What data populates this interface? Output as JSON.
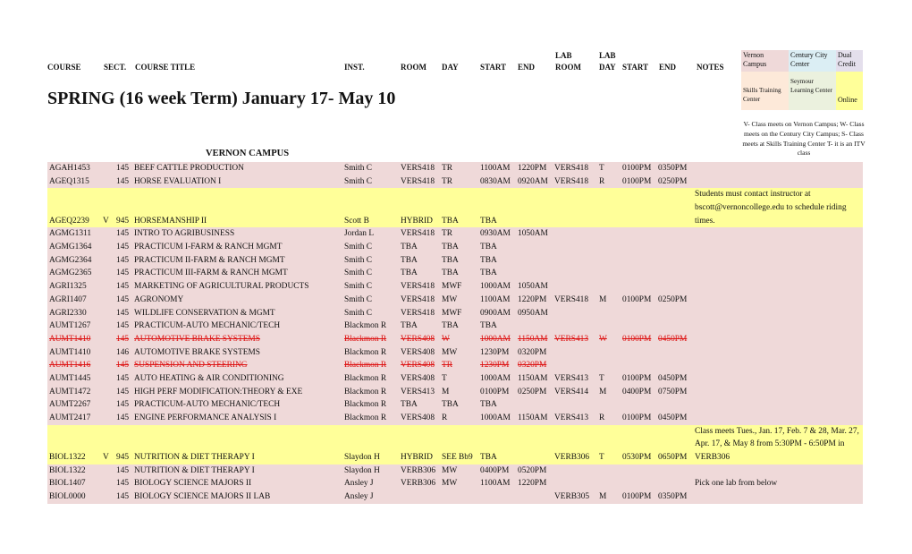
{
  "headers": {
    "course": "COURSE",
    "sect": "SECT.",
    "course_title": "COURSE TITLE",
    "inst": "INST.",
    "room": "ROOM",
    "day": "DAY",
    "start": "START",
    "end": "END",
    "lab_room_1": "LAB",
    "lab_room_2": "ROOM",
    "lab_day_1": "LAB",
    "lab_day_2": "DAY",
    "lab_start": "START",
    "lab_end": "END",
    "notes": "NOTES"
  },
  "term_title": "SPRING (16 week Term) January 17- May 10",
  "section_title": "VERNON CAMPUS",
  "legend": {
    "items": [
      {
        "label": "Vernon Campus",
        "color": "#efd9d9"
      },
      {
        "label": "Century City Center",
        "color": "#dbeef4"
      },
      {
        "label": "Dual Credit",
        "color": "#e4dfec"
      },
      {
        "label": "Skills Training Center",
        "color": "#fde9d9"
      },
      {
        "label": "Seymour Learning Center",
        "color": "#ebf1de"
      },
      {
        "label": "Online",
        "color": "#ffff99"
      }
    ],
    "note": "V- Class meets on Vernon Campus; W- Class meets on the Century City Campus; S- Class meets at Skills Training Center T- it is an ITV class"
  },
  "rows": [
    {
      "course": "AGAH1453",
      "flag": "",
      "sect": "145",
      "title": "BEEF CATTLE PRODUCTION",
      "inst": "Smith C",
      "room": "VERS418",
      "day": "TR",
      "start": "1100AM",
      "end": "1220PM",
      "lab_room": "VERS418",
      "lab_day": "T",
      "lab_start": "0100PM",
      "lab_end": "0350PM",
      "notes": "",
      "style": "pink"
    },
    {
      "course": "AGEQ1315",
      "flag": "",
      "sect": "145",
      "title": "HORSE EVALUATION I",
      "inst": "Smith C",
      "room": "VERS418",
      "day": "TR",
      "start": "0830AM",
      "end": "0920AM",
      "lab_room": "VERS418",
      "lab_day": "R",
      "lab_start": "0100PM",
      "lab_end": "0250PM",
      "notes": "",
      "style": "pink"
    },
    {
      "course": "AGEQ2239",
      "flag": "V",
      "sect": "945",
      "title": "HORSEMANSHIP II",
      "inst": "Scott B",
      "room": "HYBRID",
      "day": "TBA",
      "start": "TBA",
      "end": "",
      "lab_room": "",
      "lab_day": "",
      "lab_start": "",
      "lab_end": "",
      "notes": "Students must contact instructor at bscott@vernoncollege.edu to schedule riding times.",
      "style": "yellow"
    },
    {
      "course": "AGMG1311",
      "flag": "",
      "sect": "145",
      "title": "INTRO TO AGRIBUSINESS",
      "inst": "Jordan L",
      "room": "VERS418",
      "day": "TR",
      "start": "0930AM",
      "end": "1050AM",
      "lab_room": "",
      "lab_day": "",
      "lab_start": "",
      "lab_end": "",
      "notes": "",
      "style": "pink"
    },
    {
      "course": "AGMG1364",
      "flag": "",
      "sect": "145",
      "title": "PRACTICUM I-FARM & RANCH MGMT",
      "inst": "Smith C",
      "room": "TBA",
      "day": "TBA",
      "start": "TBA",
      "end": "",
      "lab_room": "",
      "lab_day": "",
      "lab_start": "",
      "lab_end": "",
      "notes": "",
      "style": "pink"
    },
    {
      "course": "AGMG2364",
      "flag": "",
      "sect": "145",
      "title": "PRACTICUM II-FARM & RANCH MGMT",
      "inst": "Smith C",
      "room": "TBA",
      "day": "TBA",
      "start": "TBA",
      "end": "",
      "lab_room": "",
      "lab_day": "",
      "lab_start": "",
      "lab_end": "",
      "notes": "",
      "style": "pink"
    },
    {
      "course": "AGMG2365",
      "flag": "",
      "sect": "145",
      "title": "PRACTICUM III-FARM & RANCH MGMT",
      "inst": "Smith C",
      "room": "TBA",
      "day": "TBA",
      "start": "TBA",
      "end": "",
      "lab_room": "",
      "lab_day": "",
      "lab_start": "",
      "lab_end": "",
      "notes": "",
      "style": "pink"
    },
    {
      "course": "AGRI1325",
      "flag": "",
      "sect": "145",
      "title": "MARKETING OF AGRICULTURAL PRODUCTS",
      "inst": "Smith C",
      "room": "VERS418",
      "day": "MWF",
      "start": "1000AM",
      "end": "1050AM",
      "lab_room": "",
      "lab_day": "",
      "lab_start": "",
      "lab_end": "",
      "notes": "",
      "style": "pink"
    },
    {
      "course": "AGRI1407",
      "flag": "",
      "sect": "145",
      "title": "AGRONOMY",
      "inst": "Smith C",
      "room": "VERS418",
      "day": "MW",
      "start": "1100AM",
      "end": "1220PM",
      "lab_room": "VERS418",
      "lab_day": "M",
      "lab_start": "0100PM",
      "lab_end": "0250PM",
      "notes": "",
      "style": "pink"
    },
    {
      "course": "AGRI2330",
      "flag": "",
      "sect": "145",
      "title": "WILDLIFE CONSERVATION & MGMT",
      "inst": "Smith C",
      "room": "VERS418",
      "day": "MWF",
      "start": "0900AM",
      "end": "0950AM",
      "lab_room": "",
      "lab_day": "",
      "lab_start": "",
      "lab_end": "",
      "notes": "",
      "style": "pink"
    },
    {
      "course": "AUMT1267",
      "flag": "",
      "sect": "145",
      "title": "PRACTICUM-AUTO MECHANIC/TECH",
      "inst": "Blackmon R",
      "room": "TBA",
      "day": "TBA",
      "start": "TBA",
      "end": "",
      "lab_room": "",
      "lab_day": "",
      "lab_start": "",
      "lab_end": "",
      "notes": "",
      "style": "pink"
    },
    {
      "course": "AUMT1410",
      "flag": "",
      "sect": "145",
      "title": "AUTOMOTIVE BRAKE SYSTEMS",
      "inst": "Blackmon R",
      "room": "VERS408",
      "day": "W",
      "start": "1000AM",
      "end": "1150AM",
      "lab_room": "VERS413",
      "lab_day": "W",
      "lab_start": "0100PM",
      "lab_end": "0450PM",
      "notes": "",
      "style": "pink cancel"
    },
    {
      "course": "AUMT1410",
      "flag": "",
      "sect": "146",
      "title": "AUTOMOTIVE BRAKE SYSTEMS",
      "inst": "Blackmon R",
      "room": "VERS408",
      "day": "MW",
      "start": "1230PM",
      "end": "0320PM",
      "lab_room": "",
      "lab_day": "",
      "lab_start": "",
      "lab_end": "",
      "notes": "",
      "style": "pink"
    },
    {
      "course": "AUMT1416",
      "flag": "",
      "sect": "145",
      "title": "SUSPENSION AND STEERING",
      "inst": "Blackmon R",
      "room": "VERS408",
      "day": "TR",
      "start": "1230PM",
      "end": "0320PM",
      "lab_room": "",
      "lab_day": "",
      "lab_start": "",
      "lab_end": "",
      "notes": "",
      "style": "pink cancel"
    },
    {
      "course": "AUMT1445",
      "flag": "",
      "sect": "145",
      "title": "AUTO HEATING & AIR CONDITIONING",
      "inst": "Blackmon R",
      "room": "VERS408",
      "day": "T",
      "start": "1000AM",
      "end": "1150AM",
      "lab_room": "VERS413",
      "lab_day": "T",
      "lab_start": "0100PM",
      "lab_end": "0450PM",
      "notes": "",
      "style": "pink"
    },
    {
      "course": "AUMT1472",
      "flag": "",
      "sect": "145",
      "title": "HIGH PERF MODIFICATION:THEORY & EXE",
      "inst": "Blackmon R",
      "room": "VERS413",
      "day": "M",
      "start": "0100PM",
      "end": "0250PM",
      "lab_room": "VERS414",
      "lab_day": "M",
      "lab_start": "0400PM",
      "lab_end": "0750PM",
      "notes": "",
      "style": "pink"
    },
    {
      "course": "AUMT2267",
      "flag": "",
      "sect": "145",
      "title": "PRACTICUM-AUTO MECHANIC/TECH",
      "inst": "Blackmon R",
      "room": "TBA",
      "day": "TBA",
      "start": "TBA",
      "end": "",
      "lab_room": "",
      "lab_day": "",
      "lab_start": "",
      "lab_end": "",
      "notes": "",
      "style": "pink"
    },
    {
      "course": "AUMT2417",
      "flag": "",
      "sect": "145",
      "title": "ENGINE PERFORMANCE ANALYSIS I",
      "inst": "Blackmon R",
      "room": "VERS408",
      "day": "R",
      "start": "1000AM",
      "end": "1150AM",
      "lab_room": "VERS413",
      "lab_day": "R",
      "lab_start": "0100PM",
      "lab_end": "0450PM",
      "notes": "",
      "style": "pink"
    },
    {
      "course": "BIOL1322",
      "flag": "V",
      "sect": "945",
      "title": "NUTRITION & DIET THERAPY I",
      "inst": "Slaydon H",
      "room": "HYBRID",
      "day": "SEE Bb9",
      "start": "TBA",
      "end": "",
      "lab_room": "VERB306",
      "lab_day": "T",
      "lab_start": "0530PM",
      "lab_end": "0650PM",
      "notes": "Class meets Tues., Jan. 17, Feb. 7 & 28, Mar. 27, Apr. 17, & May 8 from 5:30PM - 6:50PM in VERB306",
      "style": "yellow"
    },
    {
      "course": "BIOL1322",
      "flag": "",
      "sect": "145",
      "title": "NUTRITION & DIET THERAPY I",
      "inst": "Slaydon H",
      "room": "VERB306",
      "day": "MW",
      "start": "0400PM",
      "end": "0520PM",
      "lab_room": "",
      "lab_day": "",
      "lab_start": "",
      "lab_end": "",
      "notes": "",
      "style": "pink"
    },
    {
      "course": "BIOL1407",
      "flag": "",
      "sect": "145",
      "title": "BIOLOGY SCIENCE MAJORS II",
      "inst": "Ansley J",
      "room": "VERB306",
      "day": "MW",
      "start": "1100AM",
      "end": "1220PM",
      "lab_room": "",
      "lab_day": "",
      "lab_start": "",
      "lab_end": "",
      "notes": "Pick one lab from below",
      "style": "pink"
    },
    {
      "course": "BIOL0000",
      "flag": "",
      "sect": "145",
      "title": "BIOLOGY SCIENCE MAJORS II LAB",
      "inst": "Ansley J",
      "room": "",
      "day": "",
      "start": "",
      "end": "",
      "lab_room": "VERB305",
      "lab_day": "M",
      "lab_start": "0100PM",
      "lab_end": "0350PM",
      "notes": "",
      "style": "pink"
    }
  ]
}
